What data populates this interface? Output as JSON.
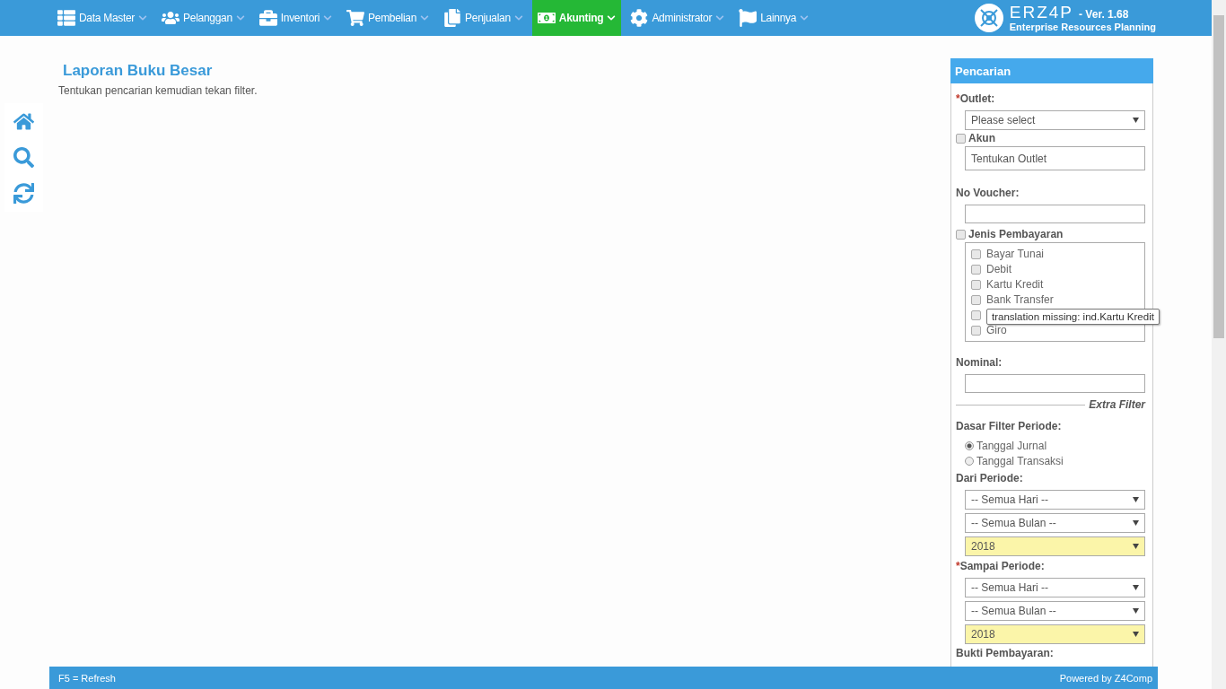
{
  "nav": {
    "items": [
      {
        "label": "Data Master",
        "selected": false
      },
      {
        "label": "Pelanggan",
        "selected": false
      },
      {
        "label": "Inventori",
        "selected": false
      },
      {
        "label": "Pembelian",
        "selected": false
      },
      {
        "label": "Penjualan",
        "selected": false
      },
      {
        "label": "Akunting",
        "selected": true
      },
      {
        "label": "Administrator",
        "selected": false
      },
      {
        "label": "Lainnya",
        "selected": false
      }
    ],
    "brand": {
      "logo_text": "ERZ4P",
      "version": "- Ver. 1.68",
      "subtitle": "Enterprise Resources Planning"
    }
  },
  "page": {
    "title": "Laporan Buku Besar",
    "hint": "Tentukan pencarian kemudian tekan filter."
  },
  "search_panel": {
    "title": "Pencarian",
    "outlet": {
      "label": "Outlet:",
      "required_mark": "*",
      "value": "Please select"
    },
    "akun": {
      "label": "Akun",
      "checked": false,
      "value": "Tentukan Outlet"
    },
    "voucher": {
      "label": "No Voucher:"
    },
    "payment": {
      "label": "Jenis Pembayaran",
      "checked": false,
      "options": [
        {
          "label": "Bayar Tunai",
          "checked": false
        },
        {
          "label": "Debit",
          "checked": false
        },
        {
          "label": "Kartu Kredit",
          "checked": false
        },
        {
          "label": "Bank Transfer",
          "checked": false
        },
        {
          "checked": false
        },
        {
          "label": "Giro",
          "checked": false
        }
      ],
      "tooltip": "translation missing: ind.Kartu Kredit"
    },
    "nominal": {
      "label": "Nominal:"
    },
    "extra_filter": "Extra Filter",
    "period_basis": {
      "label": "Dasar Filter Periode:",
      "options": [
        {
          "label": "Tanggal Jurnal",
          "selected": true
        },
        {
          "label": "Tanggal Transaksi",
          "selected": false
        }
      ]
    },
    "from": {
      "label": "Dari Periode:",
      "selects": [
        {
          "value": "-- Semua Hari --",
          "highlighted": false
        },
        {
          "value": "-- Semua Bulan --",
          "highlighted": false
        },
        {
          "value": "2018",
          "highlighted": true
        }
      ]
    },
    "to": {
      "label": "Sampai Periode:",
      "required_mark": "*",
      "selects": [
        {
          "value": "-- Semua Hari --",
          "highlighted": false
        },
        {
          "value": "-- Semua Bulan --",
          "highlighted": false
        },
        {
          "value": "2018",
          "highlighted": true
        }
      ]
    },
    "proof": {
      "label": "Bukti Pembayaran:"
    }
  },
  "footer": {
    "left": "F5 = Refresh",
    "right": "Powered by Z4Comp"
  }
}
